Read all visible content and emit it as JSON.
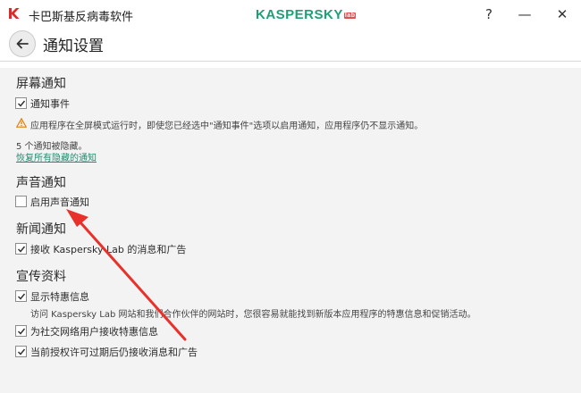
{
  "window": {
    "title": "卡巴斯基反病毒软件",
    "brand": "KASPERSKY",
    "brand_lab": "lab",
    "help": "?",
    "minimize": "—",
    "close": "✕"
  },
  "header": {
    "title": "通知设置"
  },
  "screen": {
    "title": "屏幕通知",
    "notify_events": {
      "label": "通知事件",
      "checked": true
    },
    "warning": "应用程序在全屏模式运行时，即使您已经选中\"通知事件\"选项以启用通知，应用程序仍不显示通知。",
    "hidden_count": "5 个通知被隐藏。",
    "restore_link": "恢复所有隐藏的通知"
  },
  "sound": {
    "title": "声音通知",
    "enable_sound": {
      "label": "启用声音通知",
      "checked": false
    }
  },
  "news": {
    "title": "新闻通知",
    "receive_news": {
      "label": "接收 Kaspersky Lab 的消息和广告",
      "checked": true
    }
  },
  "promo": {
    "title": "宣传资料",
    "show_offers": {
      "label": "显示特惠信息",
      "checked": true
    },
    "offers_desc": "访问 Kaspersky Lab 网站和我们合作伙伴的网站时，您很容易就能找到新版本应用程序的特惠信息和促销活动。",
    "social_offers": {
      "label": "为社交网络用户接收特惠信息",
      "checked": true
    },
    "after_expiry": {
      "label": "当前授权许可过期后仍接收消息和广告",
      "checked": true
    }
  },
  "colors": {
    "brand": "#1f9e77",
    "link": "#1e8f71",
    "annotation_arrow": "#e8312a"
  }
}
